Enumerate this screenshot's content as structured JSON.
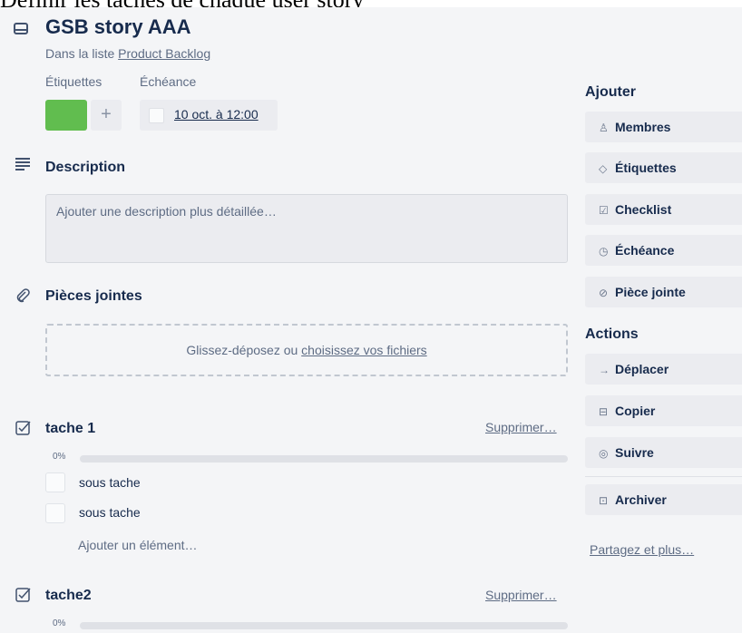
{
  "doc": {
    "heading": "Définir les taches de chaque user story"
  },
  "card": {
    "title": "GSB story AAA",
    "list_prefix": "Dans la liste ",
    "list_name": "Product Backlog",
    "labels_title": "Étiquettes",
    "due_title": "Échéance",
    "label_color": "#61bd4f",
    "add_label_symbol": "+",
    "due_value": "10 oct. à 12:00"
  },
  "description": {
    "title": "Description",
    "placeholder": "Ajouter une description plus détaillée…"
  },
  "attachments": {
    "title": "Pièces jointes",
    "drop_text": "Glissez-déposez ou ",
    "drop_link": "choisissez vos fichiers"
  },
  "checklists": [
    {
      "title": "tache 1",
      "delete_label": "Supprimer…",
      "percent": "0%",
      "progress": 0,
      "items": [
        {
          "label": "sous tache",
          "checked": false
        },
        {
          "label": "sous tache",
          "checked": false
        }
      ],
      "add_item": "Ajouter un élément…"
    },
    {
      "title": "tache2",
      "delete_label": "Supprimer…",
      "percent": "0%",
      "progress": 0
    }
  ],
  "sidebar": {
    "add_heading": "Ajouter",
    "add_buttons": [
      {
        "label": "Membres",
        "icon": "person-icon"
      },
      {
        "label": "Étiquettes",
        "icon": "tag-icon"
      },
      {
        "label": "Checklist",
        "icon": "checkbox-icon"
      },
      {
        "label": "Échéance",
        "icon": "clock-icon"
      },
      {
        "label": "Pièce jointe",
        "icon": "paperclip-icon"
      }
    ],
    "actions_heading": "Actions",
    "action_buttons": [
      {
        "label": "Déplacer",
        "icon": "arrow-right-icon"
      },
      {
        "label": "Copier",
        "icon": "card-icon"
      },
      {
        "label": "Suivre",
        "icon": "eye-icon"
      },
      {
        "label": "Archiver",
        "icon": "archive-icon"
      }
    ],
    "share_link": "Partagez et plus…"
  },
  "colors": {
    "label_green": "#61bd4f",
    "progress_blue": "#5ba4cf",
    "panel_bg": "#f4f5f7",
    "button_bg": "#ebecf0"
  }
}
